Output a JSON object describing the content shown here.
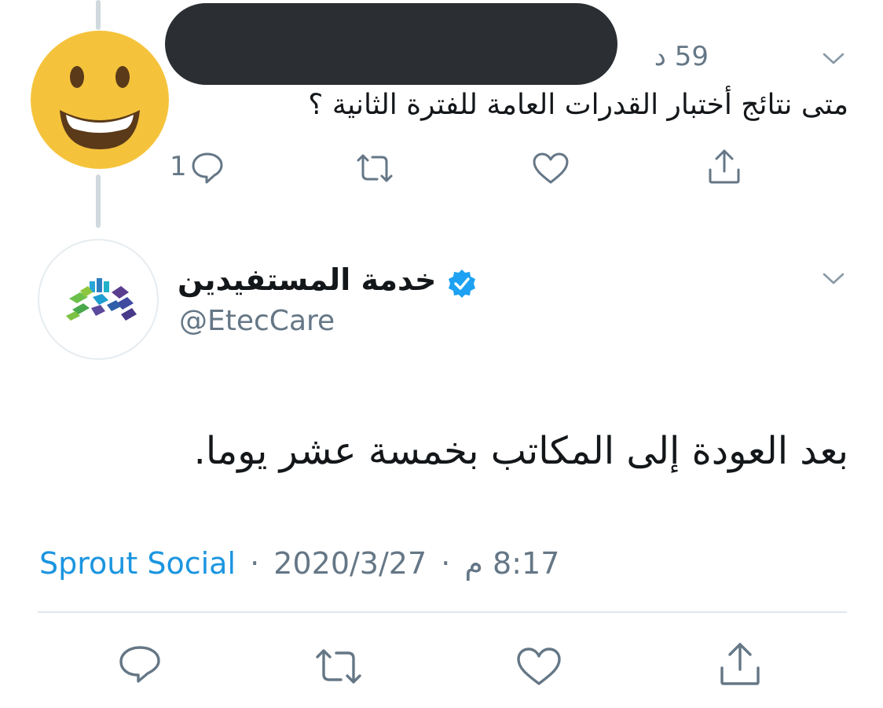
{
  "reply_tweet": {
    "avatar_emoji": "😃",
    "time": "59 د",
    "text": "متى نتائج أختبار القدرات العامة للفترة الثانية ؟",
    "reply_count": "1",
    "redacted_color": "#2b2f33"
  },
  "main_tweet": {
    "display_name": "خدمة المستفيدين",
    "handle": "@EtecCare",
    "verified": true,
    "text": "بعد العودة إلى المكاتب بخمسة عشر يوما.",
    "time": "8:17 م",
    "date": "2020/3/27",
    "separator": "·",
    "source": "Sprout Social"
  },
  "icons": {
    "reply": "reply-bubble-icon",
    "retweet": "retweet-icon",
    "like": "heart-icon",
    "share": "share-icon",
    "more": "chevron-down-icon",
    "verified": "verified-badge-icon"
  },
  "colors": {
    "text": "#14171a",
    "muted": "#657786",
    "link": "#1b95e0",
    "verified": "#1da1f2",
    "divider": "#e1e8ed",
    "avatar_yellow": "#f5c33b"
  }
}
